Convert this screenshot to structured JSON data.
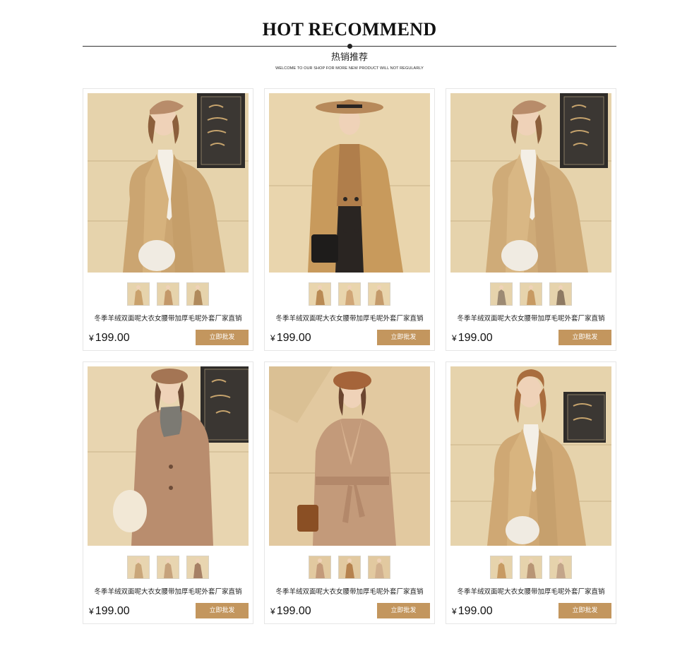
{
  "header": {
    "title": "HOT RECOMMEND",
    "subtitle": "热销推荐",
    "tagline": "WELCOME TO OUR SHOP FOR MORE NEW PRODUCT WILL NOT REGULARLY"
  },
  "currency": "¥",
  "colors": {
    "accent": "#c3965e",
    "divider": "#333333",
    "card_border": "#e6e6e6"
  },
  "products": [
    {
      "name": "冬季羊绒双面呢大衣女腰带加厚毛呢外套厂家直销",
      "price": "199.00",
      "button": "立即批发",
      "photo_icon": "beret-camel-coat-photo"
    },
    {
      "name": "冬季羊绒双面呢大衣女腰带加厚毛呢外套厂家直销",
      "price": "199.00",
      "button": "立即批发",
      "photo_icon": "hat-double-breasted-coat-photo"
    },
    {
      "name": "冬季羊绒双面呢大衣女腰带加厚毛呢外套厂家直销",
      "price": "199.00",
      "button": "立即批发",
      "photo_icon": "beret-camel-coat-photo"
    },
    {
      "name": "冬季羊绒双面呢大衣女腰带加厚毛呢外套厂家直销",
      "price": "199.00",
      "button": "立即批发",
      "photo_icon": "beret-scarf-coat-photo"
    },
    {
      "name": "冬季羊绒双面呢大衣女腰带加厚毛呢外套厂家直销",
      "price": "199.00",
      "button": "立即批发",
      "photo_icon": "belted-wrap-coat-photo"
    },
    {
      "name": "冬季羊绒双面呢大衣女腰带加厚毛呢外套厂家直销",
      "price": "199.00",
      "button": "立即批发",
      "photo_icon": "camel-coat-photo"
    }
  ]
}
